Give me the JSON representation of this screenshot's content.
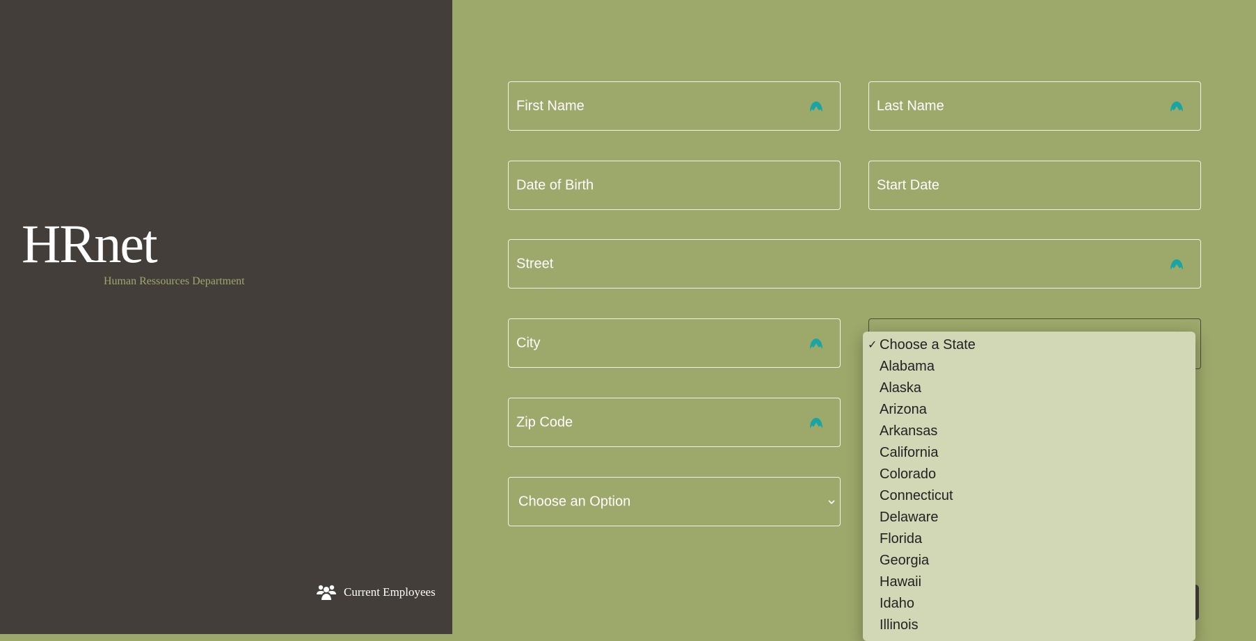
{
  "sidebar": {
    "logo": "HRnet",
    "subtitle": "Human Ressources Department",
    "nav_current_employees": "Current Employees"
  },
  "form": {
    "first_name": "First Name",
    "last_name": "Last Name",
    "date_of_birth": "Date of Birth",
    "start_date": "Start Date",
    "street": "Street",
    "city": "City",
    "zip_code": "Zip Code",
    "department_select": "Choose an Option"
  },
  "state_dropdown": {
    "selected": "Choose a State",
    "options": [
      "Choose a State",
      "Alabama",
      "Alaska",
      "Arizona",
      "Arkansas",
      "California",
      "Colorado",
      "Connecticut",
      "Delaware",
      "Florida",
      "Georgia",
      "Hawaii",
      "Idaho",
      "Illinois"
    ]
  },
  "colors": {
    "background": "#9da86b",
    "sidebar": "#433e3a",
    "dropdown": "#d2d8b6",
    "field_icon": "#1aa5a5"
  },
  "icons": {
    "field_icon": "password-manager-icon",
    "nav": "users-icon"
  }
}
